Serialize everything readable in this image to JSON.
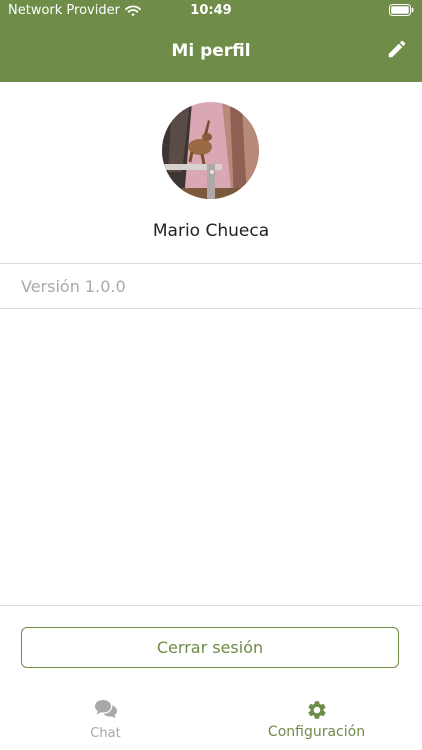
{
  "status_bar": {
    "carrier": "Network Provider",
    "time": "10:49",
    "wifi_icon": "wifi-icon",
    "battery_icon": "battery-full-icon"
  },
  "nav": {
    "title": "Mi perfil",
    "edit_icon": "pencil-icon"
  },
  "profile": {
    "name": "Mario Chueca",
    "avatar": "user-avatar-photo"
  },
  "version": {
    "label": "Versión 1.0.0"
  },
  "actions": {
    "logout_label": "Cerrar sesión"
  },
  "tab_bar": {
    "tabs": [
      {
        "label": "Chat",
        "icon": "chat-bubbles-icon",
        "selected": false
      },
      {
        "label": "Configuración",
        "icon": "gear-icon",
        "selected": true
      }
    ]
  },
  "colors": {
    "accent": "#6f8c48",
    "inactive": "#a8a8a8",
    "divider": "#dcdcdc",
    "secondary_text": "#a9a9a9"
  }
}
